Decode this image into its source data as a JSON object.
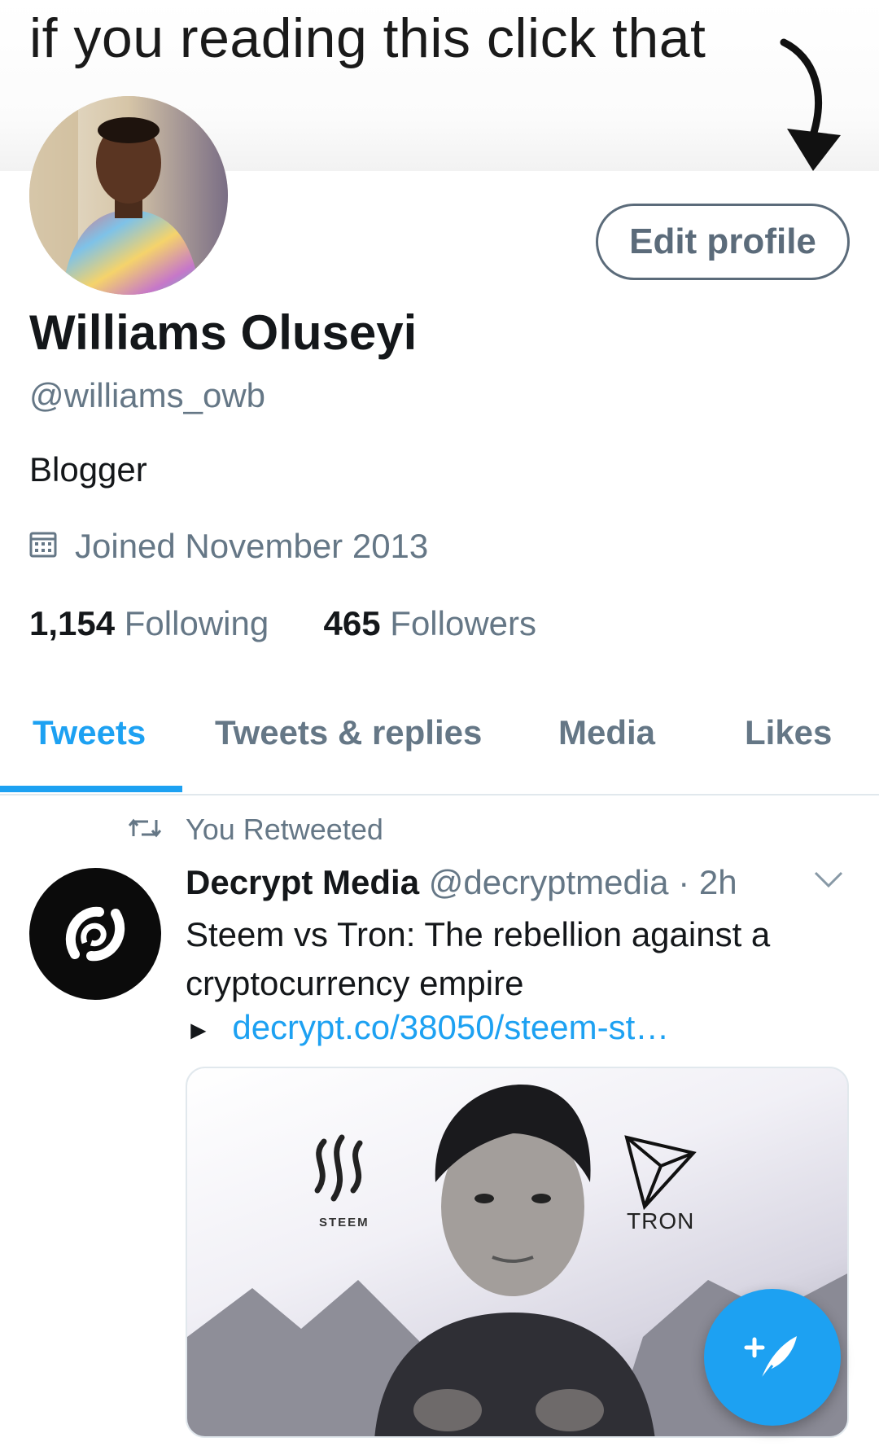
{
  "banner": {
    "text": "if you reading this click that"
  },
  "profile": {
    "name": "Williams Oluseyi",
    "handle": "@williams_owb",
    "bio": "Blogger",
    "joined": "Joined November 2013",
    "edit_label": "Edit profile",
    "following_count": "1,154",
    "following_label": "Following",
    "followers_count": "465",
    "followers_label": "Followers"
  },
  "tabs": [
    {
      "label": "Tweets",
      "active": true
    },
    {
      "label": "Tweets & replies",
      "active": false
    },
    {
      "label": "Media",
      "active": false
    },
    {
      "label": "Likes",
      "active": false
    }
  ],
  "tweet": {
    "retweet_label": "You Retweeted",
    "author": "Decrypt Media",
    "handle": "@decryptmedia",
    "time": "2h",
    "text": "Steem vs Tron: The rebellion against a cryptocurrency empire",
    "link_arrow": "►",
    "link": "decrypt.co/38050/steem-st…",
    "media_labels": {
      "left": "STEEM",
      "right": "TRON"
    }
  },
  "icons": {
    "calendar": "calendar-icon",
    "retweet": "retweet-icon",
    "chevron": "chevron-down-icon",
    "compose": "compose-tweet-icon",
    "arrow": "curved-arrow-icon"
  },
  "colors": {
    "accent": "#1da1f2",
    "secondary_text": "#657786",
    "primary_text": "#14171a"
  }
}
